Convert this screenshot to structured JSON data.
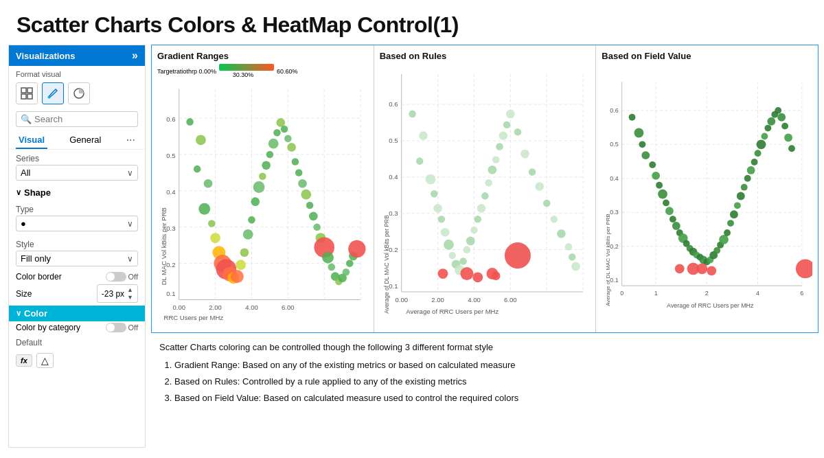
{
  "page": {
    "title": "Scatter Charts Colors & HeatMap Control(1)"
  },
  "leftPanel": {
    "visualizations_label": "Visualizations",
    "format_visual_label": "Format visual",
    "search_placeholder": "Search",
    "search_label": "Search",
    "tabs": [
      "Visual",
      "General"
    ],
    "series_label": "Series",
    "series_value": "All",
    "shape_label": "Shape",
    "type_label": "Type",
    "type_value": "●",
    "style_label": "Style",
    "style_value": "Fill only",
    "color_border_label": "Color border",
    "color_border_state": "Off",
    "size_label": "Size",
    "size_value": "-23 px",
    "color_label": "Color",
    "color_by_category_label": "Color by category",
    "color_by_category_state": "Off",
    "default_label": "Default"
  },
  "charts": {
    "chart1": {
      "title": "Gradient Ranges",
      "gradient_label_left": "Targetratiothrp 0.00%",
      "gradient_label_right": "60.60%",
      "gradient_label_mid": "30.30%",
      "xAxis": "RRC Users per MHz",
      "yAxis": "DL MAC Vol kBits per PRB"
    },
    "chart2": {
      "title": "Based on Rules",
      "xAxis": "Average of RRC Users per MHz",
      "yAxis": "Average of DL MAC Vol kBits per PRB"
    },
    "chart3": {
      "title": "Based on Field Value",
      "xAxis": "Average of RRC Users per MHz",
      "yAxis": "Average of DL MAC Vol kBits per PRB"
    }
  },
  "bottomNotes": {
    "intro": "Scatter Charts coloring can be controlled though the following 3 different format style",
    "items": [
      "Gradient Range: Based on any of the existing metrics or based on calculated measure",
      "Based on Rules: Controlled by a rule applied to any of the existing metrics",
      "Based on Field Value: Based on calculated measure used to control the required colors"
    ]
  },
  "icons": {
    "search": "🔍",
    "chevron_right": "»",
    "chevron_down": "∨",
    "dots": "···",
    "fx": "fx",
    "paint": "🪣"
  }
}
